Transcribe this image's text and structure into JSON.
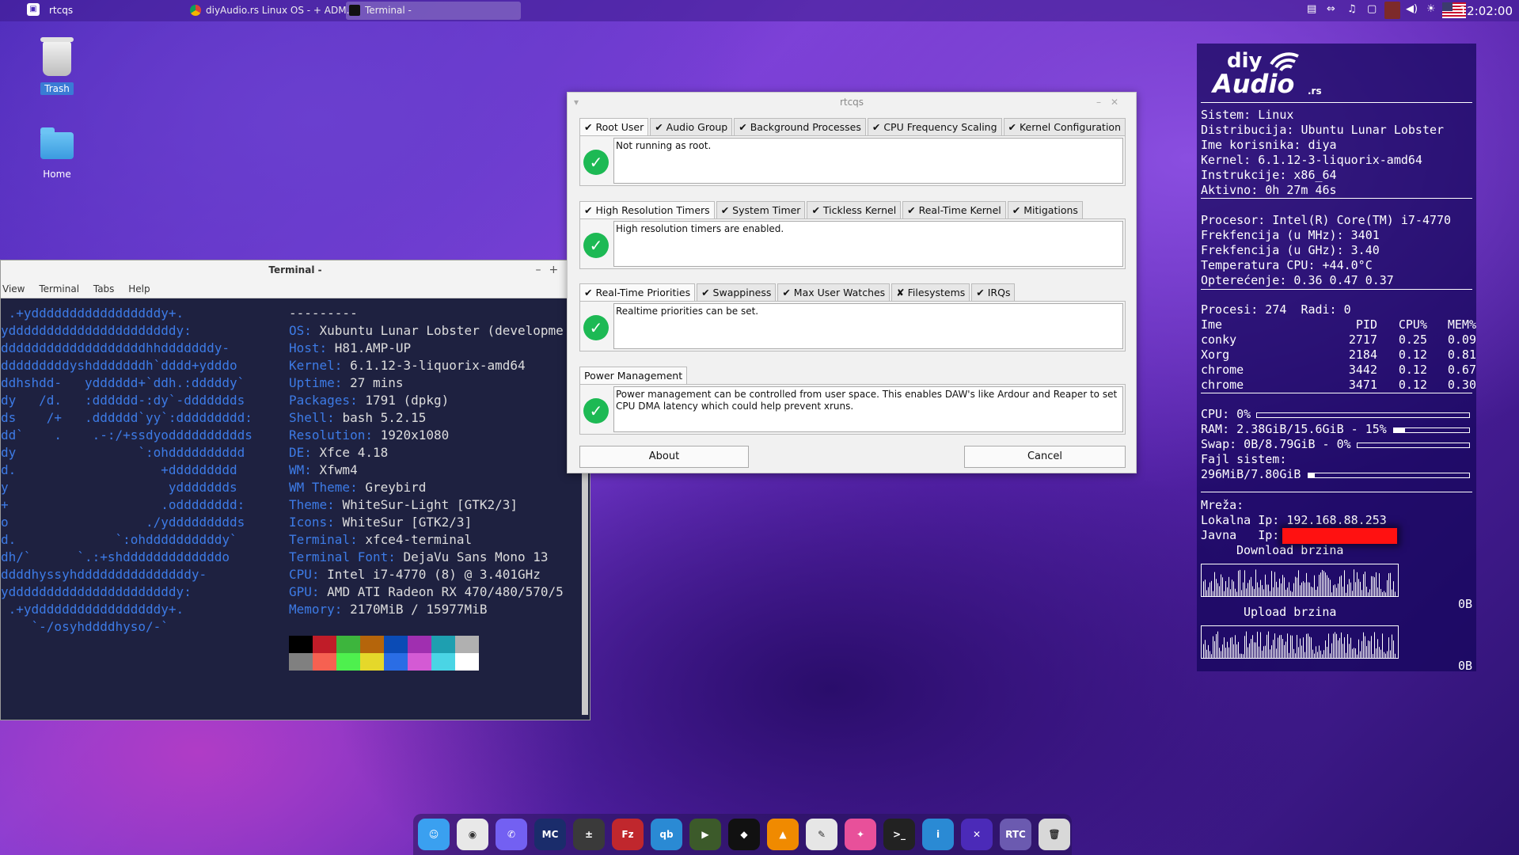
{
  "top_panel": {
    "app_name": "rtcqs",
    "tasks": [
      {
        "label": "diyAudio.rs Linux OS - + ADM..."
      },
      {
        "label": "Terminal -"
      }
    ],
    "clock": "12:02:00"
  },
  "desktop": {
    "icons": [
      {
        "label": "Trash"
      },
      {
        "label": "Home"
      }
    ]
  },
  "terminal": {
    "title": "Terminal -",
    "menu": [
      "View",
      "Terminal",
      "Tabs",
      "Help"
    ],
    "logo_lines": [
      " .+ydddddddddddddddddy+.",
      "yddddddddddddddddddddddy:",
      "dddddddddddddddddddhhdddddddy-",
      "dddddddddyshdddddddh`dddd+ydddo",
      "ddhshdd-   ydddddd+`ddh.:dddddy`",
      "dy   /d.   :dddddd-:dy`-ddddddds",
      "ds    /+   .dddddd`yy`:ddddddddd:",
      "dd`    .    .-:/+ssdyodddddddddds",
      "dy                `:ohdddddddddd",
      "d.                   +ddddddddd",
      "y                     yddddddds",
      "+                    .odddddddd:",
      "o                  ./yddddddddds",
      "d.             `:ohddddddddddy`",
      "dh/`      `.:+shdddddddddddddo",
      "ddddhyssyhdddddddddddddddy-",
      "yddddddddddddddddddddddy:",
      " .+ydddddddddddddddddy+.",
      "    `-/osyhddddhyso/-`"
    ],
    "separator": "---------",
    "info": [
      {
        "key": "OS",
        "value": "Xubuntu Lunar Lobster (developme"
      },
      {
        "key": "Host",
        "value": "H81.AMP-UP"
      },
      {
        "key": "Kernel",
        "value": "6.1.12-3-liquorix-amd64"
      },
      {
        "key": "Uptime",
        "value": "27 mins"
      },
      {
        "key": "Packages",
        "value": "1791 (dpkg)"
      },
      {
        "key": "Shell",
        "value": "bash 5.2.15"
      },
      {
        "key": "Resolution",
        "value": "1920x1080"
      },
      {
        "key": "DE",
        "value": "Xfce 4.18"
      },
      {
        "key": "WM",
        "value": "Xfwm4"
      },
      {
        "key": "WM Theme",
        "value": "Greybird"
      },
      {
        "key": "Theme",
        "value": "WhiteSur-Light [GTK2/3]"
      },
      {
        "key": "Icons",
        "value": "WhiteSur [GTK2/3]"
      },
      {
        "key": "Terminal",
        "value": "xfce4-terminal"
      },
      {
        "key": "Terminal Font",
        "value": "DejaVu Sans Mono 13"
      },
      {
        "key": "CPU",
        "value": "Intel i7-4770 (8) @ 3.401GHz"
      },
      {
        "key": "GPU",
        "value": "AMD ATI Radeon RX 470/480/570/5"
      },
      {
        "key": "Memory",
        "value": "2170MiB / 15977MiB"
      }
    ],
    "palette_top": [
      "#000000",
      "#c01c28",
      "#3db53d",
      "#b5650b",
      "#0b4bb5",
      "#a02fb0",
      "#1e9fb0",
      "#b0b0b0"
    ],
    "palette_bottom": [
      "#808080",
      "#f66151",
      "#4ef04e",
      "#e5d82a",
      "#2a6de5",
      "#d45ad4",
      "#4ad5e5",
      "#ffffff"
    ]
  },
  "rtcqs": {
    "title": "rtcqs",
    "groups": [
      {
        "tabs": [
          "✔ Root User",
          "✔ Audio Group",
          "✔ Background Processes",
          "✔ CPU Frequency Scaling",
          "✔ Kernel Configuration"
        ],
        "message": "Not running as root."
      },
      {
        "tabs": [
          "✔ High Resolution Timers",
          "✔ System Timer",
          "✔ Tickless Kernel",
          "✔ Real-Time Kernel",
          "✔ Mitigations"
        ],
        "message": "High resolution timers are enabled."
      },
      {
        "tabs": [
          "✔ Real-Time Priorities",
          "✔ Swappiness",
          "✔ Max User Watches",
          "✘ Filesystems",
          "✔ IRQs"
        ],
        "message": "Realtime priorities can be set."
      },
      {
        "tabs": [
          "Power Management"
        ],
        "message": "Power management can be controlled from user space. This enables DAW's like Ardour and Reaper to set CPU DMA latency which could help prevent xruns."
      }
    ],
    "about_label": "About",
    "cancel_label": "Cancel"
  },
  "conky": {
    "logo_main": "diy",
    "logo_sub": "Audio",
    "logo_tld": ".rs",
    "system": [
      {
        "k": "Sistem:",
        "v": "Linux"
      },
      {
        "k": "Distribucija:",
        "v": "Ubuntu Lunar Lobster"
      },
      {
        "k": "Ime korisnika:",
        "v": "diya"
      },
      {
        "k": "Kernel:",
        "v": "6.1.12-3-liquorix-amd64"
      },
      {
        "k": "Instrukcije:",
        "v": "x86_64"
      },
      {
        "k": "Aktivno:",
        "v": "0h 27m 46s"
      }
    ],
    "cpu": [
      {
        "k": "Procesor:",
        "v": "Intel(R) Core(TM) i7-4770"
      },
      {
        "k": "Frekfencija (u MHz):",
        "v": "3401"
      },
      {
        "k": "Frekfencija (u GHz):",
        "v": "3.40"
      },
      {
        "k": "Temperatura CPU:",
        "v": "+44.0°C"
      },
      {
        "k": "Opterećenje:",
        "v": "0.36 0.47 0.37"
      }
    ],
    "procs_label": "Procesi:",
    "procs_value": "274",
    "threads_label": "Radi:",
    "threads_value": "0",
    "proc_headers": [
      "Ime",
      "PID",
      "CPU%",
      "MEM%"
    ],
    "processes": [
      {
        "name": "conky",
        "pid": "2717",
        "cpu": "0.25",
        "mem": "0.09"
      },
      {
        "name": "Xorg",
        "pid": "2184",
        "cpu": "0.12",
        "mem": "0.81"
      },
      {
        "name": "chrome",
        "pid": "3442",
        "cpu": "0.12",
        "mem": "0.67"
      },
      {
        "name": "chrome",
        "pid": "3471",
        "cpu": "0.12",
        "mem": "0.30"
      }
    ],
    "cpu_usage": "CPU: 0%",
    "cpu_fraction": 0.0,
    "ram": "RAM: 2.38GiB/15.6GiB - 15%",
    "ram_fraction": 0.15,
    "swap": "Swap: 0B/8.79GiB - 0%",
    "swap_fraction": 0.0,
    "fs_label": "Fajl sistem:",
    "fs_value": "296MiB/7.80GiB",
    "fs_fraction": 0.04,
    "net_label": "Mreža:",
    "local_ip_label": "Lokalna Ip:",
    "local_ip": "192.168.88.253",
    "public_ip_label": "Javna   Ip:",
    "download_label": "Download brzina",
    "download_value": "0B",
    "upload_label": "Upload brzina",
    "upload_value": "0B"
  },
  "dock": {
    "items": [
      {
        "icon": "finder-icon",
        "color": "#3aa0f0",
        "glyph": "☺"
      },
      {
        "icon": "chrome-icon",
        "color": "#e8e8e8",
        "glyph": "◉"
      },
      {
        "icon": "viber-icon",
        "color": "#7360f2",
        "glyph": "✆"
      },
      {
        "icon": "midnight-commander-icon",
        "color": "#1a2c6b",
        "glyph": "MC"
      },
      {
        "icon": "calculator-icon",
        "color": "#3a3a3a",
        "glyph": "±"
      },
      {
        "icon": "filezilla-icon",
        "color": "#c0272d",
        "glyph": "Fz"
      },
      {
        "icon": "qbittorrent-icon",
        "color": "#2a8ad4",
        "glyph": "qb"
      },
      {
        "icon": "media-player-icon",
        "color": "#3c5a2a",
        "glyph": "▶"
      },
      {
        "icon": "tidal-icon",
        "color": "#111111",
        "glyph": "◆"
      },
      {
        "icon": "vlc-icon",
        "color": "#f08a00",
        "glyph": "▲"
      },
      {
        "icon": "text-editor-icon",
        "color": "#e6e6e6",
        "glyph": "✎"
      },
      {
        "icon": "feather-icon",
        "color": "#e8509a",
        "glyph": "✦"
      },
      {
        "icon": "terminal-icon",
        "color": "#222222",
        "glyph": ">_"
      },
      {
        "icon": "info-icon",
        "color": "#2a8ad4",
        "glyph": "i"
      },
      {
        "icon": "network-icon",
        "color": "#4b2ab8",
        "glyph": "✕"
      },
      {
        "icon": "rtcqs-icon",
        "color": "#6b5ab0",
        "glyph": "RTC"
      },
      {
        "icon": "trash-icon",
        "color": "#d8d8d8",
        "glyph": "🗑"
      }
    ]
  }
}
